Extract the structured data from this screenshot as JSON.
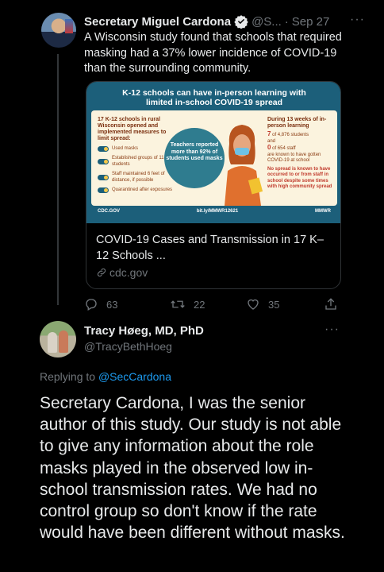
{
  "tweet1": {
    "name": "Secretary Miguel Cardona",
    "handle": "@S...",
    "separator": "·",
    "date": "Sep 27",
    "more": "···",
    "text": "A Wisconsin study found that schools that required masking had a 37% lower incidence of COVID-19 than the surrounding community.",
    "card": {
      "infographic": {
        "title_line1": "K-12 schools can have in-person learning with",
        "title_line2": "limited in-school COVID-19 spread",
        "left_heading": "17 K-12 schools in rural Wisconsin opened and implemented measures to limit spread:",
        "measures": [
          "Used masks",
          "Established groups of 11-20 students",
          "Staff maintained 6 feet of distance, if possible",
          "Quarantined after exposures"
        ],
        "bubble_text": "Teachers reported more than 92% of students used masks",
        "right_heading": "During 13 weeks of in-person learning",
        "students_num": "7",
        "students_text": "of 4,876 students",
        "and_text": "and",
        "staff_num": "0",
        "staff_text": "of 654 staff",
        "infected_text": "are known to have gotten COVID-19 at school",
        "spread_text": "No spread is known to have occurred to or from staff in school despite some times with high community spread",
        "footer_left": "CDC.GOV",
        "footer_mid": "bit.ly/MMWR12621",
        "footer_right": "MMWR"
      },
      "title": "COVID-19 Cases and Transmission in 17 K–12 Schools ...",
      "link": "cdc.gov"
    },
    "actions": {
      "replies": "63",
      "retweets": "22",
      "likes": "35"
    }
  },
  "tweet2": {
    "name": "Tracy Høeg, MD, PhD",
    "handle": "@TracyBethHoeg",
    "more": "···",
    "replying_prefix": "Replying to ",
    "replying_to": "@SecCardona",
    "text": "Secretary Cardona, I was the senior author of this study. Our study is not able to give any information about the role masks played in the observed low in-school transmission rates. We had no control group so don't know if the rate would have been different without masks."
  },
  "colors": {
    "background": "#000000",
    "text": "#e7e9ea",
    "muted": "#71767b",
    "accent": "#1d9bf0",
    "border": "#2f3336",
    "infographic_teal": "#1c5f7a",
    "infographic_cream": "#fbf3de"
  },
  "icons": [
    "verified-badge-icon",
    "reply-icon",
    "retweet-icon",
    "like-icon",
    "share-icon",
    "link-icon",
    "more-icon"
  ]
}
